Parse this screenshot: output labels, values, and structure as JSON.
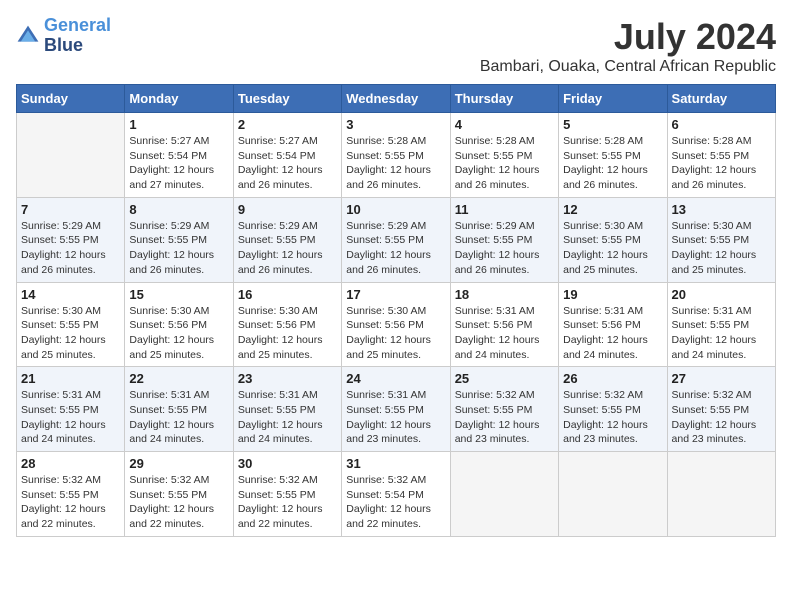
{
  "logo": {
    "line1": "General",
    "line2": "Blue"
  },
  "title": "July 2024",
  "subtitle": "Bambari, Ouaka, Central African Republic",
  "days_header": [
    "Sunday",
    "Monday",
    "Tuesday",
    "Wednesday",
    "Thursday",
    "Friday",
    "Saturday"
  ],
  "weeks": [
    [
      {
        "day": "",
        "info": ""
      },
      {
        "day": "1",
        "info": "Sunrise: 5:27 AM\nSunset: 5:54 PM\nDaylight: 12 hours\nand 27 minutes."
      },
      {
        "day": "2",
        "info": "Sunrise: 5:27 AM\nSunset: 5:54 PM\nDaylight: 12 hours\nand 26 minutes."
      },
      {
        "day": "3",
        "info": "Sunrise: 5:28 AM\nSunset: 5:55 PM\nDaylight: 12 hours\nand 26 minutes."
      },
      {
        "day": "4",
        "info": "Sunrise: 5:28 AM\nSunset: 5:55 PM\nDaylight: 12 hours\nand 26 minutes."
      },
      {
        "day": "5",
        "info": "Sunrise: 5:28 AM\nSunset: 5:55 PM\nDaylight: 12 hours\nand 26 minutes."
      },
      {
        "day": "6",
        "info": "Sunrise: 5:28 AM\nSunset: 5:55 PM\nDaylight: 12 hours\nand 26 minutes."
      }
    ],
    [
      {
        "day": "7",
        "info": "Sunrise: 5:29 AM\nSunset: 5:55 PM\nDaylight: 12 hours\nand 26 minutes."
      },
      {
        "day": "8",
        "info": "Sunrise: 5:29 AM\nSunset: 5:55 PM\nDaylight: 12 hours\nand 26 minutes."
      },
      {
        "day": "9",
        "info": "Sunrise: 5:29 AM\nSunset: 5:55 PM\nDaylight: 12 hours\nand 26 minutes."
      },
      {
        "day": "10",
        "info": "Sunrise: 5:29 AM\nSunset: 5:55 PM\nDaylight: 12 hours\nand 26 minutes."
      },
      {
        "day": "11",
        "info": "Sunrise: 5:29 AM\nSunset: 5:55 PM\nDaylight: 12 hours\nand 26 minutes."
      },
      {
        "day": "12",
        "info": "Sunrise: 5:30 AM\nSunset: 5:55 PM\nDaylight: 12 hours\nand 25 minutes."
      },
      {
        "day": "13",
        "info": "Sunrise: 5:30 AM\nSunset: 5:55 PM\nDaylight: 12 hours\nand 25 minutes."
      }
    ],
    [
      {
        "day": "14",
        "info": "Sunrise: 5:30 AM\nSunset: 5:55 PM\nDaylight: 12 hours\nand 25 minutes."
      },
      {
        "day": "15",
        "info": "Sunrise: 5:30 AM\nSunset: 5:56 PM\nDaylight: 12 hours\nand 25 minutes."
      },
      {
        "day": "16",
        "info": "Sunrise: 5:30 AM\nSunset: 5:56 PM\nDaylight: 12 hours\nand 25 minutes."
      },
      {
        "day": "17",
        "info": "Sunrise: 5:30 AM\nSunset: 5:56 PM\nDaylight: 12 hours\nand 25 minutes."
      },
      {
        "day": "18",
        "info": "Sunrise: 5:31 AM\nSunset: 5:56 PM\nDaylight: 12 hours\nand 24 minutes."
      },
      {
        "day": "19",
        "info": "Sunrise: 5:31 AM\nSunset: 5:56 PM\nDaylight: 12 hours\nand 24 minutes."
      },
      {
        "day": "20",
        "info": "Sunrise: 5:31 AM\nSunset: 5:55 PM\nDaylight: 12 hours\nand 24 minutes."
      }
    ],
    [
      {
        "day": "21",
        "info": "Sunrise: 5:31 AM\nSunset: 5:55 PM\nDaylight: 12 hours\nand 24 minutes."
      },
      {
        "day": "22",
        "info": "Sunrise: 5:31 AM\nSunset: 5:55 PM\nDaylight: 12 hours\nand 24 minutes."
      },
      {
        "day": "23",
        "info": "Sunrise: 5:31 AM\nSunset: 5:55 PM\nDaylight: 12 hours\nand 24 minutes."
      },
      {
        "day": "24",
        "info": "Sunrise: 5:31 AM\nSunset: 5:55 PM\nDaylight: 12 hours\nand 23 minutes."
      },
      {
        "day": "25",
        "info": "Sunrise: 5:32 AM\nSunset: 5:55 PM\nDaylight: 12 hours\nand 23 minutes."
      },
      {
        "day": "26",
        "info": "Sunrise: 5:32 AM\nSunset: 5:55 PM\nDaylight: 12 hours\nand 23 minutes."
      },
      {
        "day": "27",
        "info": "Sunrise: 5:32 AM\nSunset: 5:55 PM\nDaylight: 12 hours\nand 23 minutes."
      }
    ],
    [
      {
        "day": "28",
        "info": "Sunrise: 5:32 AM\nSunset: 5:55 PM\nDaylight: 12 hours\nand 22 minutes."
      },
      {
        "day": "29",
        "info": "Sunrise: 5:32 AM\nSunset: 5:55 PM\nDaylight: 12 hours\nand 22 minutes."
      },
      {
        "day": "30",
        "info": "Sunrise: 5:32 AM\nSunset: 5:55 PM\nDaylight: 12 hours\nand 22 minutes."
      },
      {
        "day": "31",
        "info": "Sunrise: 5:32 AM\nSunset: 5:54 PM\nDaylight: 12 hours\nand 22 minutes."
      },
      {
        "day": "",
        "info": ""
      },
      {
        "day": "",
        "info": ""
      },
      {
        "day": "",
        "info": ""
      }
    ]
  ]
}
